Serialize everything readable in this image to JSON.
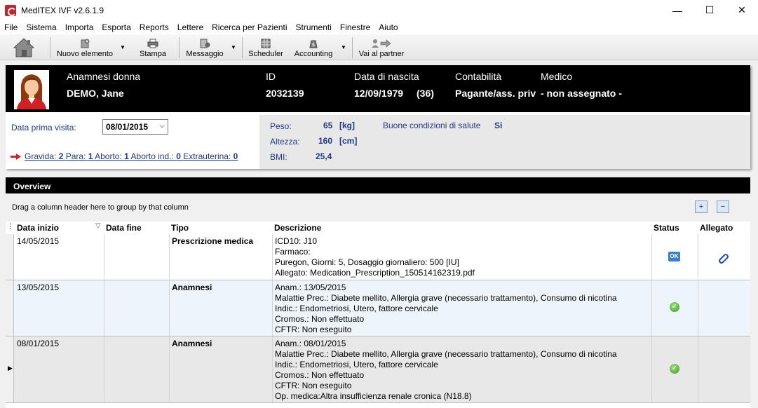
{
  "window": {
    "title": "MedITEX IVF v2.6.1.9",
    "controls": {
      "minimize": "—",
      "maximize": "☐",
      "close": "✕"
    }
  },
  "menu": [
    "File",
    "Sistema",
    "Importa",
    "Esporta",
    "Reports",
    "Lettere",
    "Ricerca per Pazienti",
    "Strumenti",
    "Finestre",
    "Aiuto"
  ],
  "toolbar": {
    "home_icon": "home-icon",
    "items": [
      {
        "label": "Nuovo elemento",
        "icon": "new-element-icon",
        "dropdown": true
      },
      {
        "label": "Stampa",
        "icon": "printer-icon",
        "dropdown": false
      },
      {
        "label": "Messaggio",
        "icon": "message-icon",
        "dropdown": true
      },
      {
        "label": "Scheduler",
        "icon": "scheduler-icon",
        "dropdown": false
      },
      {
        "label": "Accounting",
        "icon": "accounting-icon",
        "dropdown": true
      },
      {
        "label": "Vai al partner",
        "icon": "partner-icon",
        "dropdown": false
      }
    ]
  },
  "patient": {
    "section_label": "Anamnesi donna",
    "name": "DEMO, Jane",
    "id_label": "ID",
    "id_value": "2032139",
    "dob_label": "Data di nascita",
    "dob_value": "12/09/1979",
    "age": "(36)",
    "accounting_label": "Contabilità",
    "accounting_value": "Pagante/ass. priv",
    "doctor_label": "Medico",
    "doctor_value": "- non assegnato -"
  },
  "visit": {
    "first_visit_label": "Data prima visita:",
    "first_visit_value": "08/01/2015",
    "obstetric": {
      "gravida_label": "Gravida:",
      "gravida": "2",
      "para_label": "Para:",
      "para": "1",
      "aborto_label": "Aborto:",
      "aborto": "1",
      "aborto_ind_label": "Aborto ind.:",
      "aborto_ind": "0",
      "extra_label": "Extrauterina:",
      "extra": "0"
    }
  },
  "metrics": {
    "weight_label": "Peso:",
    "weight_value": "65",
    "weight_unit": "[kg]",
    "height_label": "Altezza:",
    "height_value": "160",
    "height_unit": "[cm]",
    "bmi_label": "BMI:",
    "bmi_value": "25,4",
    "health_label": "Buone condizioni di salute",
    "health_value": "Si"
  },
  "overview": {
    "title": "Overview",
    "group_hint": "Drag a column header here to group by that column",
    "expand_label": "+",
    "collapse_label": "−",
    "columns": [
      "Data inizio",
      "Data fine",
      "Tipo",
      "Descrizione",
      "Status",
      "Allegato"
    ],
    "rows": [
      {
        "data_inizio": "14/05/2015",
        "data_fine": "",
        "tipo": "Prescrizione medica",
        "descrizione": [
          "ICD10: J10",
          "Farmaco:",
          "Puregon, Giorni: 5, Dosaggio giornaliero: 500 [IU]",
          "Allegato: Medication_Prescription_150514162319.pdf"
        ],
        "status": "ok",
        "status_text": "OK",
        "allegato": true
      },
      {
        "data_inizio": "13/05/2015",
        "data_fine": "",
        "tipo": "Anamnesi",
        "descrizione": [
          "Anam.: 13/05/2015",
          "Malattie Prec.: Diabete mellito, Allergia grave (necessario trattamento), Consumo di nicotina",
          "Indic.: Endometriosi, Utero, fattore cervicale",
          "Cromos.: Non effettuato",
          "CFTR: Non eseguito"
        ],
        "status": "check",
        "status_text": "✓",
        "allegato": false
      },
      {
        "data_inizio": "08/01/2015",
        "data_fine": "",
        "tipo": "Anamnesi",
        "descrizione": [
          "Anam.: 08/01/2015",
          "Malattie Prec.: Diabete mellito, Allergia grave (necessario trattamento), Consumo di nicotina",
          "Indic.: Endometriosi, Utero, fattore cervicale",
          "Cromos.: Non effettuato",
          "CFTR: Non eseguito",
          "Op. medica:Altra insufficienza renale cronica (N18.8)"
        ],
        "status": "check",
        "status_text": "✓",
        "allegato": false
      }
    ]
  }
}
